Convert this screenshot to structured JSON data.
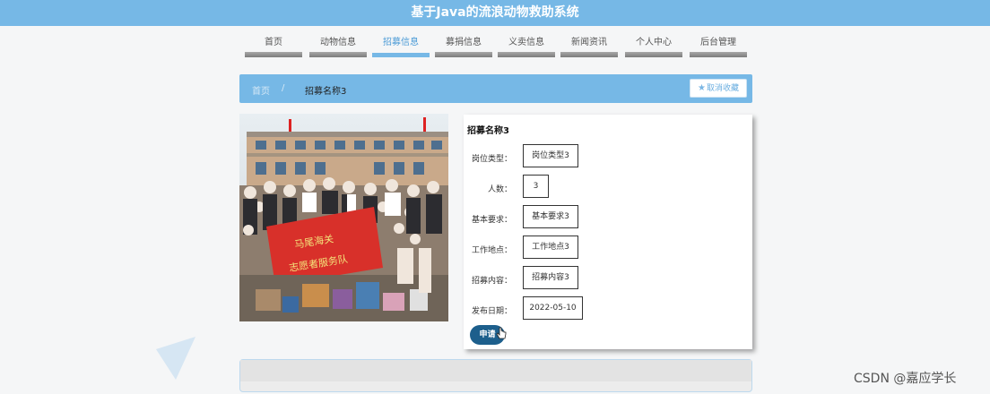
{
  "header": {
    "title": "基于Java的流浪动物救助系统"
  },
  "nav": {
    "items": [
      "首页",
      "动物信息",
      "招募信息",
      "募捐信息",
      "义卖信息",
      "新闻资讯",
      "个人中心",
      "后台管理"
    ],
    "active_index": 2
  },
  "breadcrumb": {
    "home": "首页",
    "separator": "/",
    "current": "招募名称3"
  },
  "favorite": {
    "label": "取消收藏",
    "icon": "star-icon"
  },
  "detail": {
    "title": "招募名称3",
    "rows": [
      {
        "label": "岗位类型：",
        "value": "岗位类型3"
      },
      {
        "label": "人数：",
        "value": "3"
      },
      {
        "label": "基本要求：",
        "value": "基本要求3"
      },
      {
        "label": "工作地点：",
        "value": "工作地点3"
      },
      {
        "label": "招募内容：",
        "value": "招募内容3"
      },
      {
        "label": "发布日期：",
        "value": "2022-05-10"
      }
    ],
    "apply_label": "申请"
  },
  "photo": {
    "banner_line1": "马尾海关",
    "banner_line2": "志愿者服务队"
  },
  "watermark": "CSDN @嘉应学长",
  "colors": {
    "accent": "#76b8e6",
    "apply_button": "#1d5f8c",
    "banner_red": "#d8302a"
  }
}
